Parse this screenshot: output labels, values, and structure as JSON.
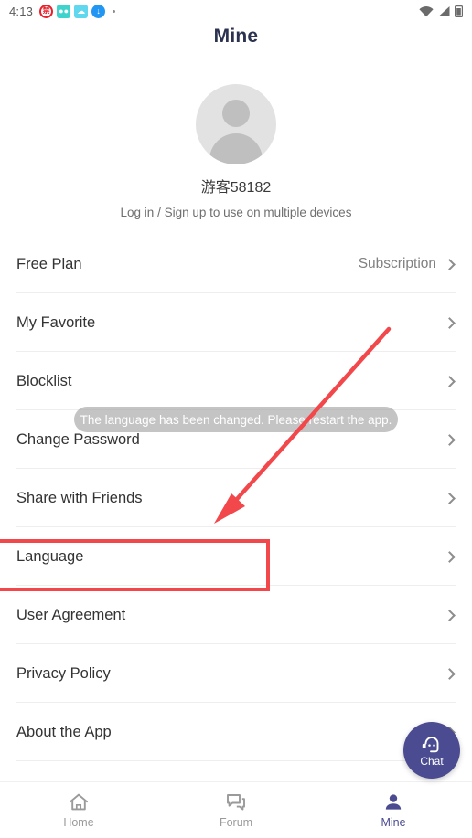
{
  "status_bar": {
    "time": "4:13",
    "notification_icons": [
      {
        "name": "blocked-circle-icon",
        "glyph": "禁"
      },
      {
        "name": "car-app-icon",
        "glyph": "▬"
      },
      {
        "name": "cloud-app-icon",
        "glyph": "☁"
      },
      {
        "name": "download-icon",
        "glyph": "⬇"
      }
    ],
    "overflow_dot": "·",
    "right_icons": [
      "wifi-icon",
      "cellular-signal-icon",
      "battery-icon"
    ]
  },
  "header": {
    "title": "Mine"
  },
  "profile": {
    "avatar_alt": "default-user-avatar",
    "username": "游客58182",
    "subtitle": "Log in / Sign up to use on multiple devices"
  },
  "menu": {
    "items": [
      {
        "label": "Free Plan",
        "value": "Subscription",
        "name": "free-plan",
        "highlighted": false
      },
      {
        "label": "My Favorite",
        "value": "",
        "name": "my-favorite",
        "highlighted": false
      },
      {
        "label": "Blocklist",
        "value": "",
        "name": "blocklist",
        "highlighted": false
      },
      {
        "label": "Change Password",
        "value": "",
        "name": "change-password",
        "highlighted": false
      },
      {
        "label": "Share with Friends",
        "value": "",
        "name": "share-with-friends",
        "highlighted": false
      },
      {
        "label": "Language",
        "value": "",
        "name": "language",
        "highlighted": true
      },
      {
        "label": "User Agreement",
        "value": "",
        "name": "user-agreement",
        "highlighted": false
      },
      {
        "label": "Privacy Policy",
        "value": "",
        "name": "privacy-policy",
        "highlighted": false
      },
      {
        "label": "About the App",
        "value": "",
        "name": "about-the-app",
        "highlighted": false
      }
    ]
  },
  "toast": {
    "message": "The language has been changed. Please restart the app."
  },
  "floating_action": {
    "label": "Chat",
    "icon": "robot-chat-icon"
  },
  "bottom_nav": {
    "items": [
      {
        "label": "Home",
        "icon": "home-icon",
        "active": false
      },
      {
        "label": "Forum",
        "icon": "forum-icon",
        "active": false
      },
      {
        "label": "Mine",
        "icon": "person-icon",
        "active": true
      }
    ]
  },
  "annotation": {
    "highlight_color": "#f2474b",
    "arrow_color": "#f2474b",
    "target": "Language"
  },
  "colors": {
    "accent_purple": "#4b4b91",
    "title_navy": "#2c3350",
    "annotation_red": "#f2474b",
    "divider_gray": "#eeeeee"
  }
}
